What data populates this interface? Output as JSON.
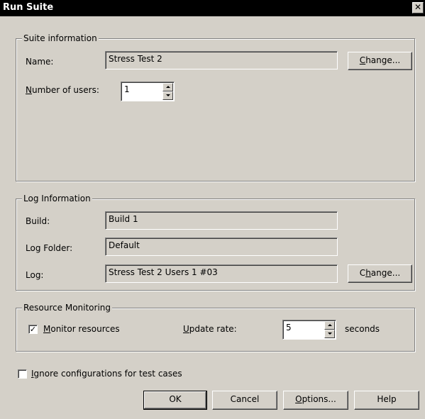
{
  "window": {
    "title": "Run Suite",
    "close_glyph": "✕"
  },
  "suite": {
    "group_label": "Suite information",
    "name_label": "Name:",
    "name_value": "Stress Test 2",
    "change_label_pre": "",
    "change_label_ul": "C",
    "change_label_post": "hange...",
    "users_label_ul": "N",
    "users_label_post": "umber of users:",
    "users_value": "1"
  },
  "log": {
    "group_label": "Log Information",
    "build_label": "Build:",
    "build_value": "Build 1",
    "folder_label": "Log Folder:",
    "folder_value": "Default",
    "log_label": "Log:",
    "log_value": "Stress Test 2 Users  1 #03",
    "change_label_pre": "C",
    "change_label_ul": "h",
    "change_label_post": "ange..."
  },
  "resource": {
    "group_label": "Resource Monitoring",
    "monitor_checked": true,
    "monitor_label_ul": "M",
    "monitor_label_post": "onitor resources",
    "rate_label_ul": "U",
    "rate_label_post": "pdate rate:",
    "rate_value": "5",
    "rate_unit": "seconds"
  },
  "ignore": {
    "checked": false,
    "label_ul": "I",
    "label_post": "gnore configurations for test cases"
  },
  "buttons": {
    "ok": "OK",
    "cancel": "Cancel",
    "options_ul": "O",
    "options_post": "ptions...",
    "help": "Help"
  },
  "icons": {
    "spin_up": "spin-up-arrow",
    "spin_down": "spin-down-arrow",
    "check": "✓"
  }
}
